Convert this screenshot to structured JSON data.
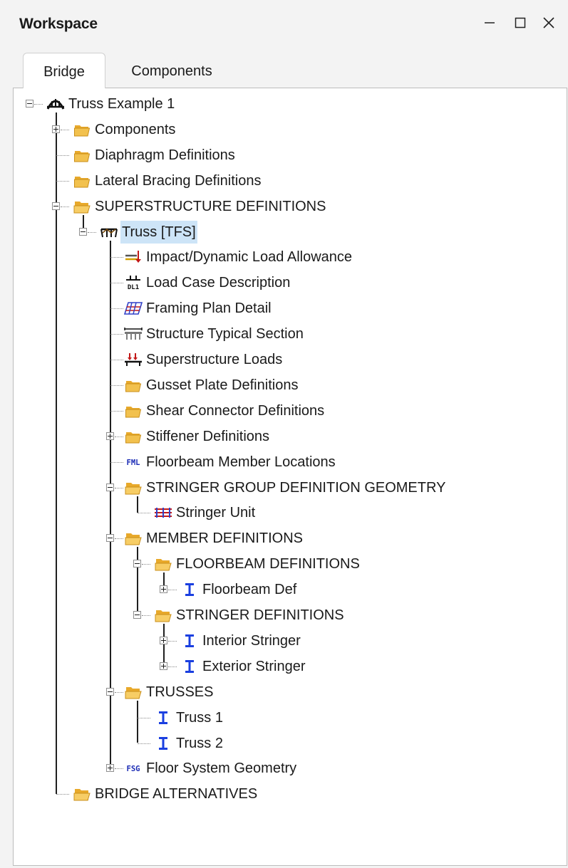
{
  "window": {
    "title": "Workspace"
  },
  "tabs": [
    {
      "label": "Bridge",
      "active": true
    },
    {
      "label": "Components",
      "active": false
    }
  ],
  "tree": [
    {
      "label": "Truss Example 1",
      "icon": "bridge-icon",
      "expanded": true
    },
    {
      "label": "Components",
      "icon": "folder-icon",
      "expanded": false
    },
    {
      "label": "Diaphragm Definitions",
      "icon": "folder-icon"
    },
    {
      "label": "Lateral Bracing Definitions",
      "icon": "folder-icon"
    },
    {
      "label": "SUPERSTRUCTURE DEFINITIONS",
      "icon": "open-folder-icon",
      "expanded": true
    },
    {
      "label": "Truss [TFS]",
      "icon": "truss-icon",
      "expanded": true,
      "selected": true
    },
    {
      "label": "Impact/Dynamic Load Allowance",
      "icon": "impact-load-icon"
    },
    {
      "label": "Load Case Description",
      "icon": "load-case-icon",
      "icon_text": "DL1"
    },
    {
      "label": "Framing Plan Detail",
      "icon": "framing-plan-icon"
    },
    {
      "label": "Structure Typical Section",
      "icon": "typical-section-icon"
    },
    {
      "label": "Superstructure Loads",
      "icon": "superstructure-loads-icon"
    },
    {
      "label": "Gusset Plate Definitions",
      "icon": "folder-icon"
    },
    {
      "label": "Shear Connector Definitions",
      "icon": "folder-icon"
    },
    {
      "label": "Stiffener Definitions",
      "icon": "folder-icon",
      "expanded": false
    },
    {
      "label": "Floorbeam Member Locations",
      "icon": "fml-icon",
      "icon_text": "FML"
    },
    {
      "label": "STRINGER GROUP DEFINITION GEOMETRY",
      "icon": "open-folder-icon",
      "expanded": true
    },
    {
      "label": "Stringer Unit",
      "icon": "stringer-unit-icon"
    },
    {
      "label": "MEMBER DEFINITIONS",
      "icon": "open-folder-icon",
      "expanded": true
    },
    {
      "label": "FLOORBEAM DEFINITIONS",
      "icon": "open-folder-icon",
      "expanded": true
    },
    {
      "label": "Floorbeam Def",
      "icon": "i-beam-icon",
      "expanded": false
    },
    {
      "label": "STRINGER DEFINITIONS",
      "icon": "open-folder-icon",
      "expanded": true
    },
    {
      "label": "Interior Stringer",
      "icon": "i-beam-icon",
      "expanded": false
    },
    {
      "label": "Exterior Stringer",
      "icon": "i-beam-icon",
      "expanded": false
    },
    {
      "label": "TRUSSES",
      "icon": "open-folder-icon",
      "expanded": true
    },
    {
      "label": "Truss 1",
      "icon": "i-beam-icon"
    },
    {
      "label": "Truss 2",
      "icon": "i-beam-icon"
    },
    {
      "label": "Floor System Geometry",
      "icon": "fsg-icon",
      "icon_text": "FSG",
      "expanded": false
    },
    {
      "label": "BRIDGE ALTERNATIVES",
      "icon": "open-folder-icon"
    }
  ],
  "colors": {
    "selection": "#cde4f7",
    "i_beam": "#1a3fe0",
    "folder": "#f2c14e",
    "label_code": "#1b2bb5"
  }
}
